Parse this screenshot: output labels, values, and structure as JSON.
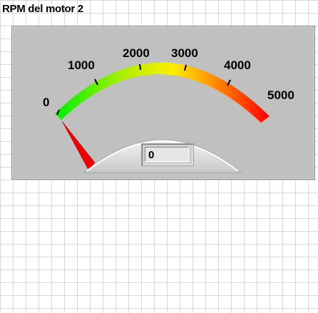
{
  "gauge": {
    "caption": "RPM del motor 2",
    "scale_labels": [
      "0",
      "1000",
      "2000",
      "3000",
      "4000",
      "5000"
    ],
    "value": 0,
    "digital_display": "0",
    "min": 0,
    "max": 5000,
    "colors": {
      "low": "#00ee00",
      "mid": "#ffee00",
      "high": "#ff0000",
      "needle": "#ee0000",
      "panel": "#c0c0c0"
    }
  }
}
